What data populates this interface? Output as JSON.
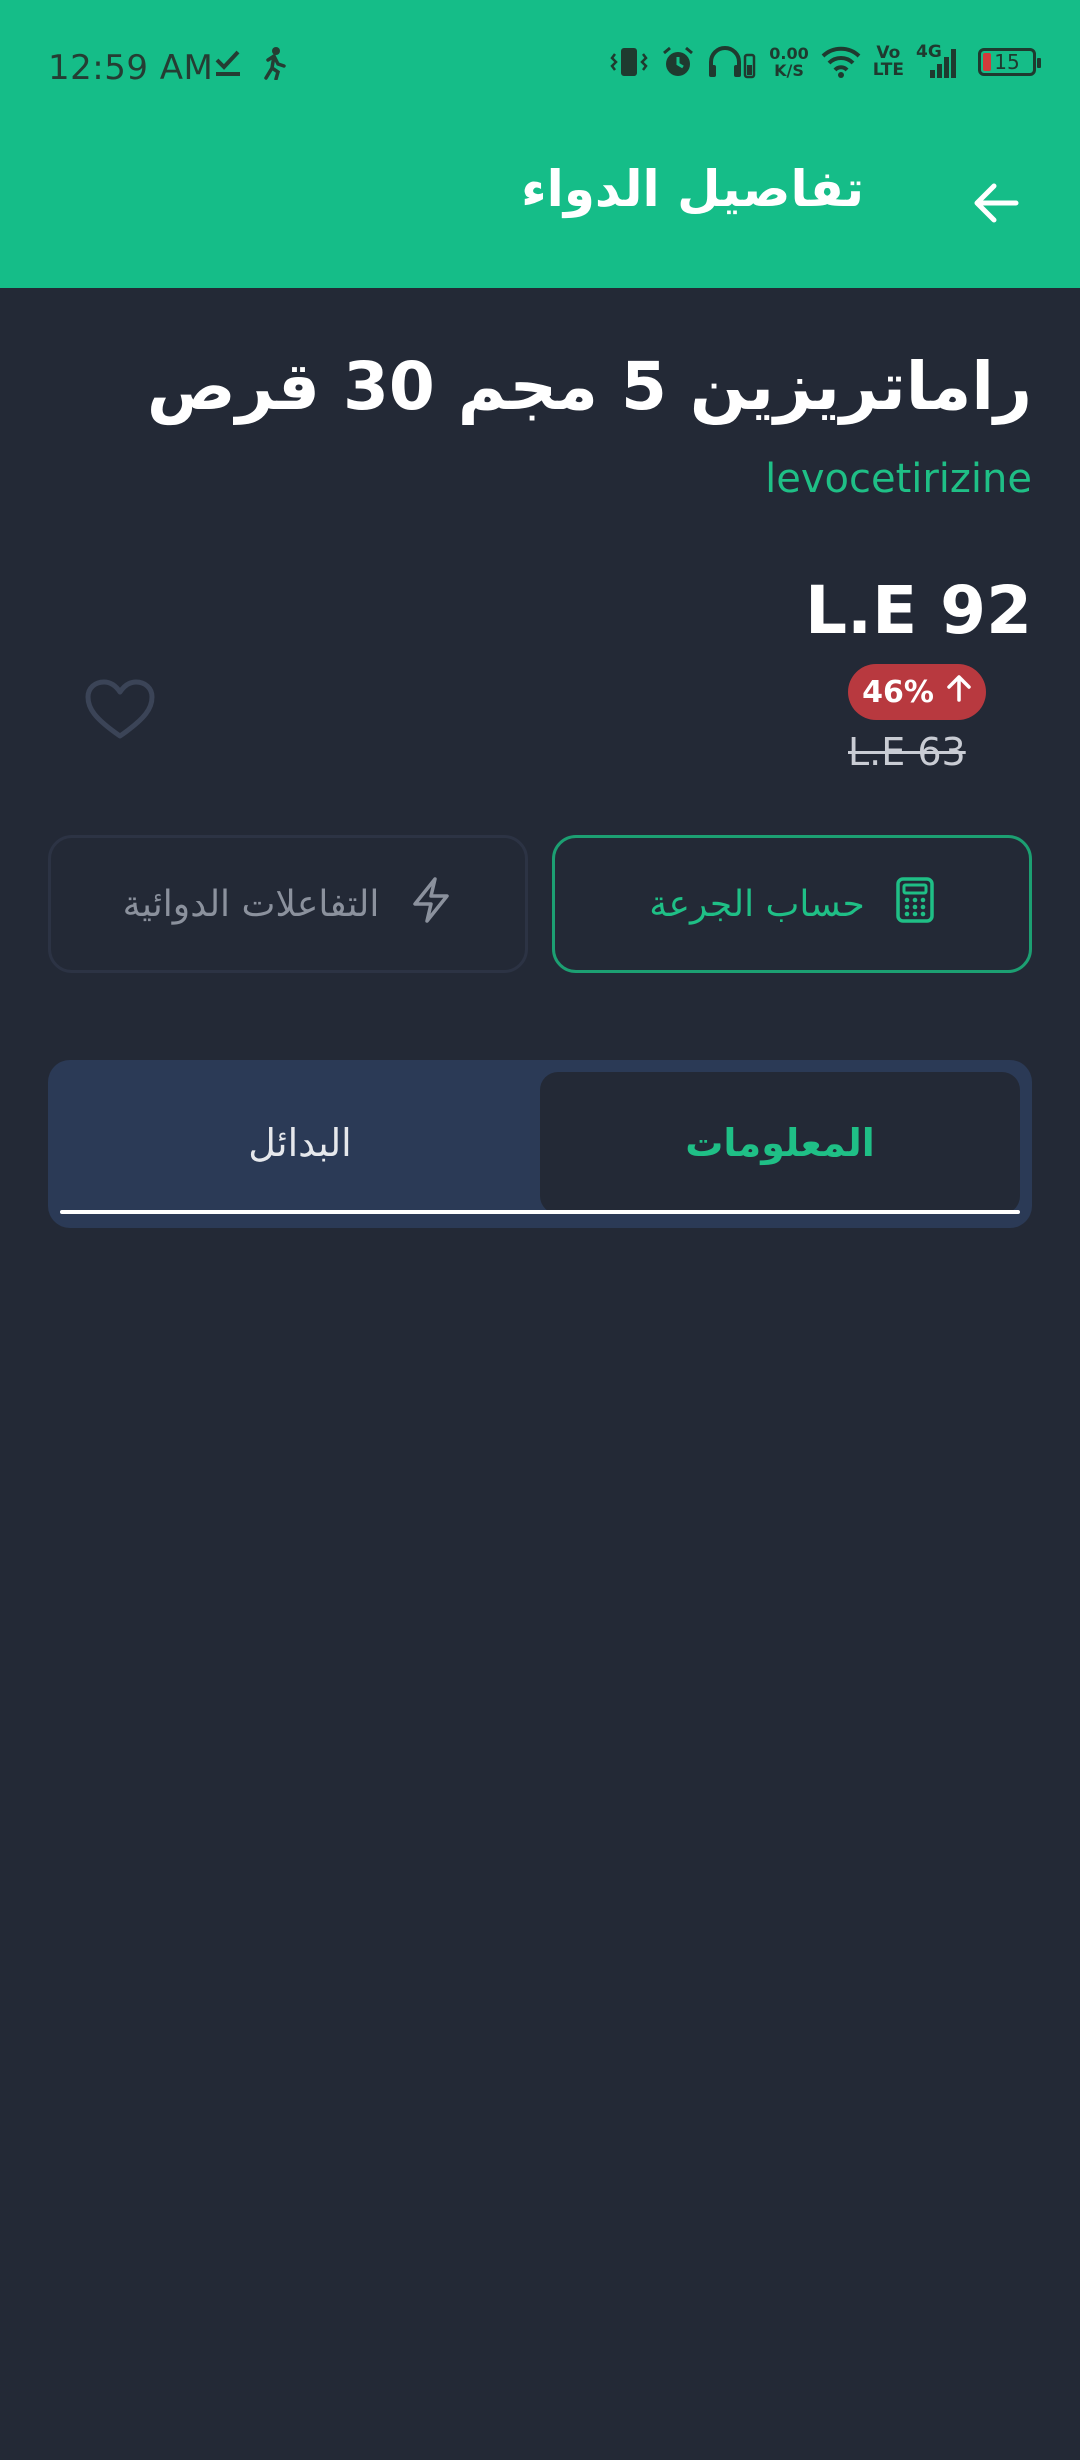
{
  "status_bar": {
    "time": "12:59 AM",
    "net_speed_value": "0.00",
    "net_speed_unit": "K/S",
    "lte_top": "Vo",
    "lte_bottom": "LTE",
    "network_type": "4G",
    "battery_level": "15"
  },
  "header": {
    "title": "تفاصيل الدواء",
    "back_icon": "arrow-back-icon"
  },
  "drug": {
    "name": "راماتريزين 5 مجم 30 قرص",
    "generic_name": "levocetirizine",
    "price": "L.E 92",
    "change_percent": "46%",
    "change_direction": "up",
    "old_price": "L.E 63",
    "favorite_icon": "heart-outline-icon"
  },
  "actions": {
    "dose_calculator_label": "حساب الجرعة",
    "dose_calculator_icon": "calculator-icon",
    "interactions_label": "التفاعلات الدوائية",
    "interactions_icon": "lightning-icon"
  },
  "tabs": [
    {
      "label": "المعلومات",
      "selected": true
    },
    {
      "label": "البدائل",
      "selected": false
    }
  ],
  "colors": {
    "accent": "#15bd88",
    "background": "#232936",
    "badge_red": "#b8393f",
    "tab_bar": "#2b3a56"
  }
}
